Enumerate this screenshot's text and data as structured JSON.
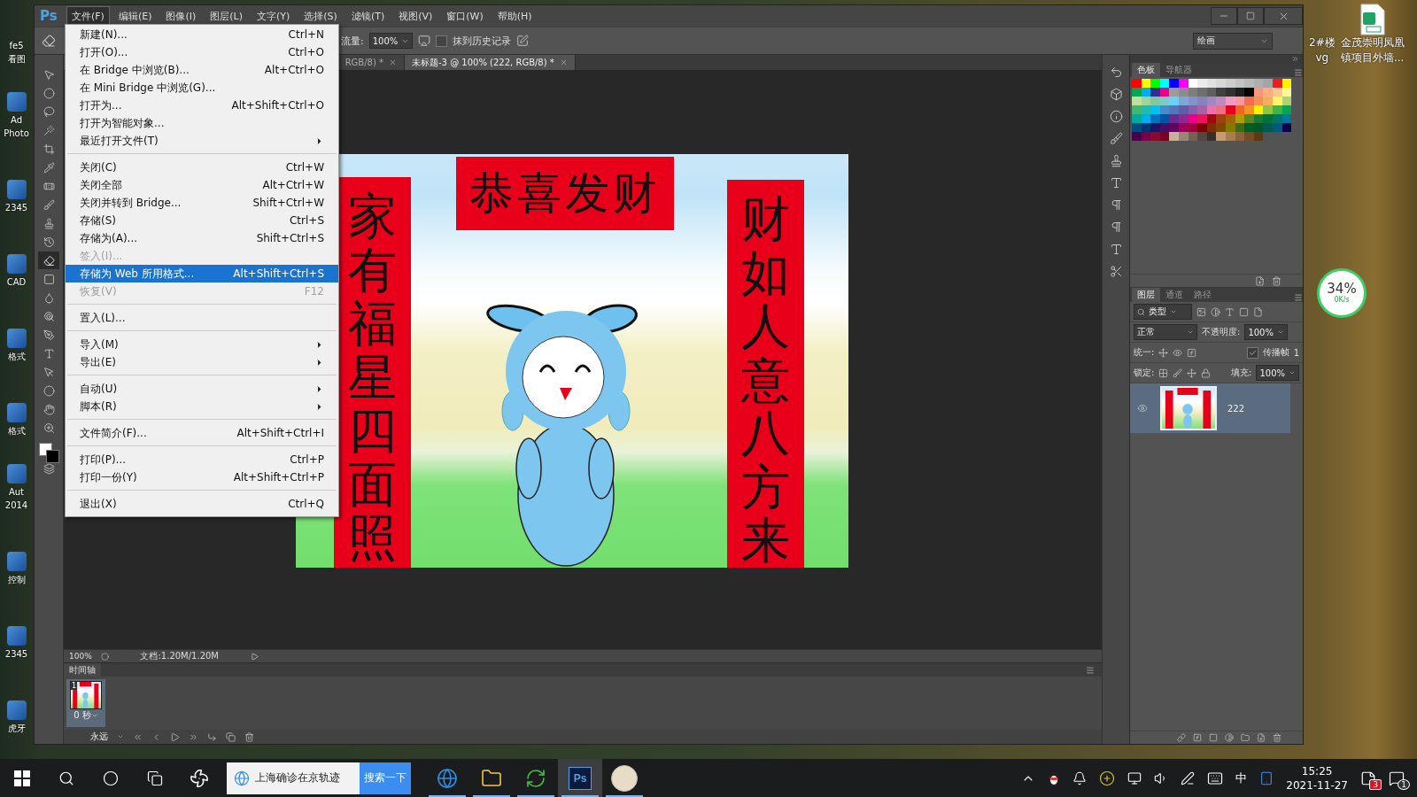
{
  "desktop": {
    "left_icons": [
      {
        "lines": [
          "fe5",
          "看图"
        ]
      },
      {
        "lines": [
          "Ad",
          "Photo"
        ]
      },
      {
        "lines": [
          "2345"
        ]
      },
      {
        "lines": [
          "CAD"
        ]
      },
      {
        "lines": [
          "格式"
        ]
      },
      {
        "lines": [
          "格式"
        ]
      },
      {
        "lines": [
          "Aut",
          "2014"
        ]
      },
      {
        "lines": [
          "控制"
        ]
      },
      {
        "lines": [
          "2345"
        ]
      },
      {
        "lines": [
          "虎牙"
        ]
      }
    ],
    "right_icons": [
      {
        "kind": "partial",
        "lines": [
          "2#楼",
          "vg"
        ]
      },
      {
        "kind": "spreadsheet",
        "lines": [
          "金茂崇明凤凰",
          "镇项目外墙..."
        ]
      }
    ],
    "speed_widget": {
      "percent": "34%",
      "rate": "0K/s"
    }
  },
  "photoshop": {
    "logo": "Ps",
    "menu": [
      {
        "label": "文件(F)",
        "selected": true
      },
      {
        "label": "编辑(E)",
        "selected": false
      },
      {
        "label": "图像(I)",
        "selected": false
      },
      {
        "label": "图层(L)",
        "selected": false
      },
      {
        "label": "文字(Y)",
        "selected": false
      },
      {
        "label": "选择(S)",
        "selected": false
      },
      {
        "label": "滤镜(T)",
        "selected": false
      },
      {
        "label": "视图(V)",
        "selected": false
      },
      {
        "label": "窗口(W)",
        "selected": false
      },
      {
        "label": "帮助(H)",
        "selected": false
      }
    ],
    "options_bar": {
      "flow_label": "流量:",
      "flow_value": "100%",
      "history_label": "抹到历史记录",
      "history_checked": false,
      "workspace": "绘画"
    },
    "tabs": [
      {
        "label": "RGB/8) *",
        "selected": false
      },
      {
        "label": "未标题-3 @ 100% (222, RGB/8) *",
        "selected": true
      }
    ],
    "tools": [
      {
        "kind": "move",
        "selected": false
      },
      {
        "kind": "marquee",
        "selected": false
      },
      {
        "kind": "lasso",
        "selected": false
      },
      {
        "kind": "wand",
        "selected": false
      },
      {
        "kind": "crop",
        "selected": false
      },
      {
        "kind": "eyedropper",
        "selected": false
      },
      {
        "kind": "healing",
        "selected": false
      },
      {
        "kind": "brush",
        "selected": false
      },
      {
        "kind": "stamp",
        "selected": false
      },
      {
        "kind": "history",
        "selected": false
      },
      {
        "kind": "eraser",
        "selected": true
      },
      {
        "kind": "gradient",
        "selected": false
      },
      {
        "kind": "blur",
        "selected": false
      },
      {
        "kind": "dodge",
        "selected": false
      },
      {
        "kind": "pen",
        "selected": false
      },
      {
        "kind": "type",
        "selected": false
      },
      {
        "kind": "path",
        "selected": false
      },
      {
        "kind": "shape",
        "selected": false
      },
      {
        "kind": "hand",
        "selected": false
      },
      {
        "kind": "zoom",
        "selected": false
      }
    ],
    "artwork": {
      "top_banner": "恭喜发财",
      "left_couplet": "家有福星四面照",
      "right_couplet": "财如人意八方来"
    },
    "status_bar": {
      "zoom": "100%",
      "doc": "文档:1.20M/1.20M"
    },
    "timeline": {
      "title": "时间轴",
      "frames": [
        {
          "number": "1",
          "delay": "0 秒",
          "selected": true
        }
      ],
      "loop": "永远"
    },
    "swatches_tabs": [
      {
        "label": "色板",
        "selected": true
      },
      {
        "label": "导航器",
        "selected": false
      }
    ],
    "swatches": [
      {
        "color": "#ff0000"
      },
      {
        "color": "#ffff00"
      },
      {
        "color": "#00ff00"
      },
      {
        "color": "#00ffff"
      },
      {
        "color": "#0000ff"
      },
      {
        "color": "#ff00ff"
      },
      {
        "color": "#ffffff"
      },
      {
        "color": "#ebebeb"
      },
      {
        "color": "#e1e1e1"
      },
      {
        "color": "#d7d7d7"
      },
      {
        "color": "#cdcdcd"
      },
      {
        "color": "#c3c3c3"
      },
      {
        "color": "#b9b9b9"
      },
      {
        "color": "#afafaf"
      },
      {
        "color": "#a5a5a5"
      },
      {
        "color": "#ed1c24"
      },
      {
        "color": "#fff200"
      },
      {
        "color": "#00a651"
      },
      {
        "color": "#00aeef"
      },
      {
        "color": "#2e3192"
      },
      {
        "color": "#ec008c"
      },
      {
        "color": "#9b9b9b"
      },
      {
        "color": "#8c8c8c"
      },
      {
        "color": "#7d7d7d"
      },
      {
        "color": "#6e6e6e"
      },
      {
        "color": "#5f5f5f"
      },
      {
        "color": "#414141"
      },
      {
        "color": "#323232"
      },
      {
        "color": "#1e1e1e"
      },
      {
        "color": "#000000"
      },
      {
        "color": "#f7977a"
      },
      {
        "color": "#f9ad81"
      },
      {
        "color": "#fdc68a"
      },
      {
        "color": "#fff79a"
      },
      {
        "color": "#c4df9b"
      },
      {
        "color": "#a3d39c"
      },
      {
        "color": "#82ca9c"
      },
      {
        "color": "#7accc8"
      },
      {
        "color": "#6dcff6"
      },
      {
        "color": "#7da7d9"
      },
      {
        "color": "#8393ca"
      },
      {
        "color": "#8781bd"
      },
      {
        "color": "#a187be"
      },
      {
        "color": "#bc8cbf"
      },
      {
        "color": "#f49ac1"
      },
      {
        "color": "#f6989d"
      },
      {
        "color": "#f26c4f"
      },
      {
        "color": "#f68e56"
      },
      {
        "color": "#fbaf5d"
      },
      {
        "color": "#fff568"
      },
      {
        "color": "#acd373"
      },
      {
        "color": "#3cb878"
      },
      {
        "color": "#1cbbb4"
      },
      {
        "color": "#00bff3"
      },
      {
        "color": "#448ccb"
      },
      {
        "color": "#5674b9"
      },
      {
        "color": "#605ca8"
      },
      {
        "color": "#855fa8"
      },
      {
        "color": "#a863a8"
      },
      {
        "color": "#f06ea9"
      },
      {
        "color": "#f26d7d"
      },
      {
        "color": "#e8001c"
      },
      {
        "color": "#f26522"
      },
      {
        "color": "#f7941d"
      },
      {
        "color": "#fff100"
      },
      {
        "color": "#8dc73f"
      },
      {
        "color": "#39b54a"
      },
      {
        "color": "#00a650"
      },
      {
        "color": "#00a99d"
      },
      {
        "color": "#00adef"
      },
      {
        "color": "#0072bc"
      },
      {
        "color": "#0054a6"
      },
      {
        "color": "#662d91"
      },
      {
        "color": "#92278f"
      },
      {
        "color": "#eb008b"
      },
      {
        "color": "#ed145b"
      },
      {
        "color": "#9e0b0f"
      },
      {
        "color": "#a0410d"
      },
      {
        "color": "#a36209"
      },
      {
        "color": "#aba000"
      },
      {
        "color": "#598527"
      },
      {
        "color": "#197b30"
      },
      {
        "color": "#007236"
      },
      {
        "color": "#00746b"
      },
      {
        "color": "#0076a3"
      },
      {
        "color": "#004b80"
      },
      {
        "color": "#003471"
      },
      {
        "color": "#1b1464"
      },
      {
        "color": "#440e62"
      },
      {
        "color": "#630460"
      },
      {
        "color": "#9e005d"
      },
      {
        "color": "#9e0039"
      },
      {
        "color": "#790000"
      },
      {
        "color": "#7b2e00"
      },
      {
        "color": "#7d4900"
      },
      {
        "color": "#827b00"
      },
      {
        "color": "#406618"
      },
      {
        "color": "#005e20"
      },
      {
        "color": "#005826"
      },
      {
        "color": "#005952"
      },
      {
        "color": "#005b7f"
      },
      {
        "color": "#0d004c"
      },
      {
        "color": "#4b0049"
      },
      {
        "color": "#7b0046"
      },
      {
        "color": "#8a0a2a"
      },
      {
        "color": "#7a0026"
      },
      {
        "color": "#c7b299"
      },
      {
        "color": "#998675"
      },
      {
        "color": "#736357"
      },
      {
        "color": "#534741"
      },
      {
        "color": "#37302a"
      },
      {
        "color": "#c69c6d"
      },
      {
        "color": "#a67c52"
      },
      {
        "color": "#8c6239"
      },
      {
        "color": "#754c24"
      },
      {
        "color": "#603913"
      }
    ],
    "layers_tabs": [
      {
        "label": "图层",
        "selected": true
      },
      {
        "label": "通道",
        "selected": false
      },
      {
        "label": "路径",
        "selected": false
      }
    ],
    "layers_panel": {
      "filter": "类型",
      "blend_mode": "正常",
      "opacity_label": "不透明度:",
      "opacity": "100%",
      "unify_label": "统一:",
      "propagate_label": "传播帧",
      "propagate_checked": true,
      "propagate_count": "1",
      "lock_label": "锁定:",
      "fill_label": "填充:",
      "fill": "100%"
    },
    "layers": [
      {
        "name": "222",
        "visible": true,
        "selected": true
      }
    ]
  },
  "file_menu": {
    "groups": [
      {
        "items": [
          {
            "label": "新建(N)...",
            "shortcut": "Ctrl+N",
            "submenu": false,
            "disabled": false,
            "selected": false
          },
          {
            "label": "打开(O)...",
            "shortcut": "Ctrl+O",
            "submenu": false,
            "disabled": false,
            "selected": false
          },
          {
            "label": "在 Bridge 中浏览(B)...",
            "shortcut": "Alt+Ctrl+O",
            "submenu": false,
            "disabled": false,
            "selected": false
          },
          {
            "label": "在 Mini Bridge 中浏览(G)...",
            "submenu": false,
            "disabled": false,
            "selected": false
          },
          {
            "label": "打开为...",
            "shortcut": "Alt+Shift+Ctrl+O",
            "submenu": false,
            "disabled": false,
            "selected": false
          },
          {
            "label": "打开为智能对象...",
            "submenu": false,
            "disabled": false,
            "selected": false
          },
          {
            "label": "最近打开文件(T)",
            "submenu": true,
            "disabled": false,
            "selected": false
          }
        ]
      },
      {
        "items": [
          {
            "label": "关闭(C)",
            "shortcut": "Ctrl+W",
            "submenu": false,
            "disabled": false,
            "selected": false
          },
          {
            "label": "关闭全部",
            "shortcut": "Alt+Ctrl+W",
            "submenu": false,
            "disabled": false,
            "selected": false
          },
          {
            "label": "关闭并转到 Bridge...",
            "shortcut": "Shift+Ctrl+W",
            "submenu": false,
            "disabled": false,
            "selected": false
          },
          {
            "label": "存储(S)",
            "shortcut": "Ctrl+S",
            "submenu": false,
            "disabled": false,
            "selected": false
          },
          {
            "label": "存储为(A)...",
            "shortcut": "Shift+Ctrl+S",
            "submenu": false,
            "disabled": false,
            "selected": false
          },
          {
            "label": "签入(I)...",
            "submenu": false,
            "disabled": true,
            "selected": false
          },
          {
            "label": "存储为 Web 所用格式...",
            "shortcut": "Alt+Shift+Ctrl+S",
            "submenu": false,
            "disabled": false,
            "selected": true
          },
          {
            "label": "恢复(V)",
            "shortcut": "F12",
            "submenu": false,
            "disabled": true,
            "selected": false
          }
        ]
      },
      {
        "items": [
          {
            "label": "置入(L)...",
            "submenu": false,
            "disabled": false,
            "selected": false
          }
        ]
      },
      {
        "items": [
          {
            "label": "导入(M)",
            "submenu": true,
            "disabled": false,
            "selected": false
          },
          {
            "label": "导出(E)",
            "submenu": true,
            "disabled": false,
            "selected": false
          }
        ]
      },
      {
        "items": [
          {
            "label": "自动(U)",
            "submenu": true,
            "disabled": false,
            "selected": false
          },
          {
            "label": "脚本(R)",
            "submenu": true,
            "disabled": false,
            "selected": false
          }
        ]
      },
      {
        "items": [
          {
            "label": "文件简介(F)...",
            "shortcut": "Alt+Shift+Ctrl+I",
            "submenu": false,
            "disabled": false,
            "selected": false
          }
        ]
      },
      {
        "items": [
          {
            "label": "打印(P)...",
            "shortcut": "Ctrl+P",
            "submenu": false,
            "disabled": false,
            "selected": false
          },
          {
            "label": "打印一份(Y)",
            "shortcut": "Alt+Shift+Ctrl+P",
            "submenu": false,
            "disabled": false,
            "selected": false
          }
        ]
      },
      {
        "items": [
          {
            "label": "退出(X)",
            "shortcut": "Ctrl+Q",
            "submenu": false,
            "disabled": false,
            "selected": false
          }
        ]
      }
    ]
  },
  "taskbar": {
    "search_text": "上海确诊在京轨迹",
    "search_button": "搜索一下",
    "apps": [
      {
        "kind": "browser",
        "running": true,
        "active": false
      },
      {
        "kind": "folder",
        "running": true,
        "active": false
      },
      {
        "kind": "refresh",
        "running": true,
        "active": false
      },
      {
        "kind": "photoshop",
        "label": "Ps",
        "running": true,
        "active": true
      },
      {
        "kind": "avatar",
        "running": true,
        "active": false
      }
    ],
    "ime": "中",
    "time": "15:25",
    "date": "2021-11-27",
    "notification_count": "3",
    "action_count": "1"
  }
}
